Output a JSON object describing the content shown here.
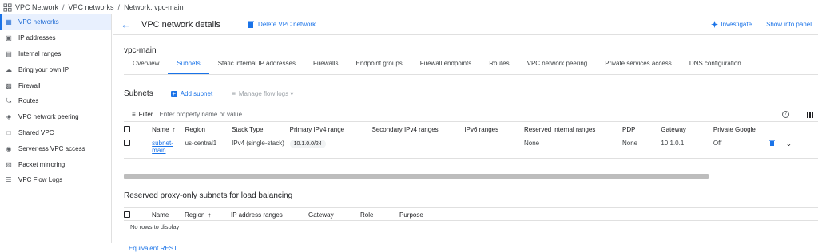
{
  "breadcrumb": {
    "root": "VPC Network",
    "mid": "VPC networks",
    "current": "Network: vpc-main",
    "separator": "/"
  },
  "sidebar": {
    "items": [
      {
        "label": "VPC networks",
        "icon": "vpc-networks-icon",
        "active": true
      },
      {
        "label": "IP addresses",
        "icon": "ip-addresses-icon"
      },
      {
        "label": "Internal ranges",
        "icon": "internal-ranges-icon"
      },
      {
        "label": "Bring your own IP",
        "icon": "byoip-icon"
      },
      {
        "label": "Firewall",
        "icon": "firewall-icon"
      },
      {
        "label": "Routes",
        "icon": "routes-icon"
      },
      {
        "label": "VPC network peering",
        "icon": "peering-icon"
      },
      {
        "label": "Shared VPC",
        "icon": "shared-vpc-icon"
      },
      {
        "label": "Serverless VPC access",
        "icon": "serverless-icon"
      },
      {
        "label": "Packet mirroring",
        "icon": "packet-mirroring-icon"
      },
      {
        "label": "VPC Flow Logs",
        "icon": "flow-logs-icon"
      }
    ]
  },
  "header": {
    "title": "VPC network details",
    "delete_label": "Delete VPC network",
    "investigate_label": "Investigate",
    "show_info_label": "Show info panel"
  },
  "network_name": "vpc-main",
  "tabs": [
    {
      "label": "Overview"
    },
    {
      "label": "Subnets",
      "active": true
    },
    {
      "label": "Static internal IP addresses"
    },
    {
      "label": "Firewalls"
    },
    {
      "label": "Endpoint groups"
    },
    {
      "label": "Firewall endpoints"
    },
    {
      "label": "Routes"
    },
    {
      "label": "VPC network peering"
    },
    {
      "label": "Private services access"
    },
    {
      "label": "DNS configuration"
    }
  ],
  "subnets": {
    "heading": "Subnets",
    "add_label": "Add subnet",
    "flow_logs_label": "Manage flow logs",
    "filter_label": "Filter",
    "filter_placeholder": "Enter property name or value",
    "columns": [
      "Name",
      "Region",
      "Stack Type",
      "Primary IPv4 range",
      "Secondary IPv4 ranges",
      "IPv6 ranges",
      "Reserved internal ranges",
      "PDP",
      "Gateway",
      "Private Google"
    ],
    "rows": [
      {
        "name": "subnet-main",
        "region": "us-central1",
        "stack_type": "IPv4 (single-stack)",
        "primary_range": "10.1.0.0/24",
        "secondary_ranges": "",
        "ipv6_ranges": "",
        "reserved_ranges": "None",
        "pdp": "None",
        "gateway": "10.1.0.1",
        "private_google": "Off"
      }
    ]
  },
  "reserved": {
    "heading": "Reserved proxy-only subnets for load balancing",
    "columns": [
      "Name",
      "Region",
      "IP address ranges",
      "Gateway",
      "Role",
      "Purpose"
    ],
    "empty": "No rows to display"
  },
  "equivalent_rest": "Equivalent REST",
  "colors": {
    "accent": "#1a73e8",
    "active_bg": "#e8f0fe"
  }
}
